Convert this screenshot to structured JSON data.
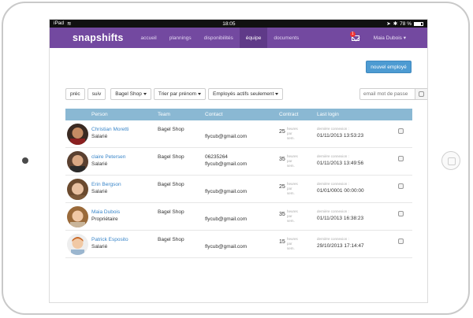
{
  "status_bar": {
    "device": "iPad",
    "time": "18:05",
    "battery": "78 %"
  },
  "nav": {
    "logo": "snapshifts",
    "links": [
      "accueil",
      "plannings",
      "disponibilités",
      "équipe",
      "documents"
    ],
    "active_index": 3,
    "notification_count": "1",
    "user": "Maia Dubois"
  },
  "actions": {
    "new_employee": "nouvel employé"
  },
  "filters": {
    "prev": "préc",
    "next": "suiv",
    "shop": "Bagel Shop",
    "sort": "Trier par prénom",
    "active": "Employés actifs seulement",
    "search_placeholder": "email mot de passe"
  },
  "table": {
    "headers": [
      "Person",
      "Team",
      "Contact",
      "Contract",
      "Last login"
    ],
    "contract_unit": "heures par sem.",
    "last_login_label": "dernière connexion :",
    "rows": [
      {
        "name": "Christian Moretti",
        "role": "Salarié",
        "team": "Bagel Shop",
        "phone": "",
        "email": "flycub@gmail.com",
        "contract": "25",
        "last_login": "01/11/2013 13:53:23"
      },
      {
        "name": "claire Petersen",
        "role": "Salarié",
        "team": "Bagel Shop",
        "phone": "06235264",
        "email": "flycub@gmail.com",
        "contract": "35",
        "last_login": "01/11/2013 13:49:56"
      },
      {
        "name": "Erin Bergson",
        "role": "Salarié",
        "team": "Bagel Shop",
        "phone": "",
        "email": "flycub@gmail.com",
        "contract": "25",
        "last_login": "01/01/0001 00:00:00"
      },
      {
        "name": "Maia Dubois",
        "role": "Propriétaire",
        "team": "Bagel Shop",
        "phone": "",
        "email": "flycub@gmail.com",
        "contract": "35",
        "last_login": "01/11/2013 16:38:23"
      },
      {
        "name": "Patrick Esposito",
        "role": "Salarié",
        "team": "Bagel Shop",
        "phone": "",
        "email": "flycub@gmail.com",
        "contract": "15",
        "last_login": "29/10/2013 17:14:47"
      }
    ]
  },
  "colors": {
    "nav": "#7349a0",
    "nav_active": "#5f3a88",
    "table_header": "#8ab8d3",
    "primary_button": "#4d9bd2",
    "link": "#3a86c9"
  }
}
